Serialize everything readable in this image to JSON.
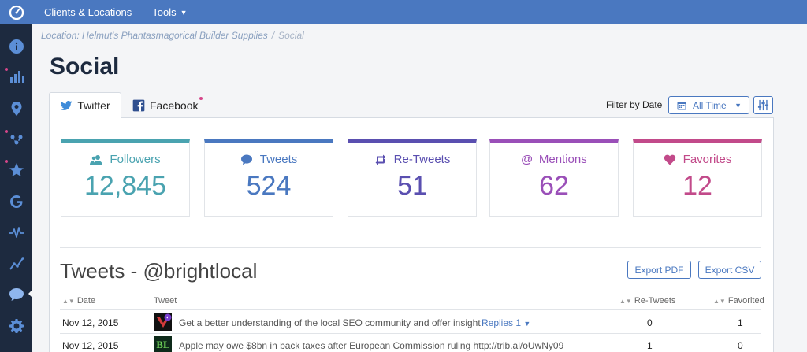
{
  "topbar": {
    "nav": [
      {
        "label": "Clients & Locations"
      },
      {
        "label": "Tools"
      }
    ]
  },
  "breadcrumb": {
    "location": "Location: Helmut's Phantasmagorical Builder Supplies",
    "separator": "/",
    "current": "Social"
  },
  "page": {
    "title": "Social"
  },
  "tabs": {
    "twitter": "Twitter",
    "facebook": "Facebook"
  },
  "filter": {
    "label": "Filter by Date",
    "value": "All Time"
  },
  "colors": {
    "followers": "#4aa3b0",
    "tweets": "#4a78c0",
    "retweets": "#5a4fb0",
    "mentions": "#9a4fb8",
    "favorites": "#c24a8a"
  },
  "stats": [
    {
      "label": "Followers",
      "value": "12,845",
      "icon": "followers-icon"
    },
    {
      "label": "Tweets",
      "value": "524",
      "icon": "speech-bubble-icon"
    },
    {
      "label": "Re-Tweets",
      "value": "51",
      "icon": "retweet-icon"
    },
    {
      "label": "Mentions",
      "value": "62",
      "icon": "at-icon"
    },
    {
      "label": "Favorites",
      "value": "12",
      "icon": "heart-icon"
    }
  ],
  "tweets_section": {
    "title": "Tweets - @brightlocal",
    "export_pdf": "Export PDF",
    "export_csv": "Export CSV",
    "columns": {
      "date": "Date",
      "tweet": "Tweet",
      "retweets": "Re-Tweets",
      "favorited": "Favorited"
    },
    "rows": [
      {
        "date": "Nov 12, 2015",
        "text": "Get a better understanding of the local SEO community and offer insight",
        "replies": "Replies 1",
        "retweets": "0",
        "favorited": "1"
      },
      {
        "date": "Nov 12, 2015",
        "text": "Apple may owe $8bn in back taxes after European Commission ruling http://trib.al/oUwNy09",
        "thumb_text": "BL",
        "retweets": "1",
        "favorited": "0"
      }
    ]
  }
}
